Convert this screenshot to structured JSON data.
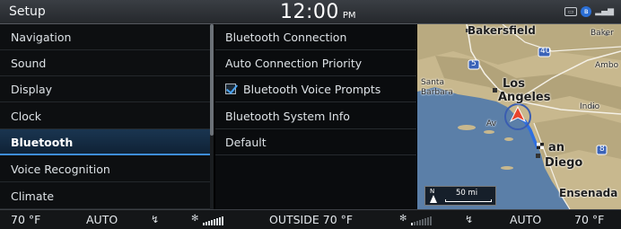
{
  "header": {
    "title": "Setup",
    "time": "12:00",
    "ampm": "PM",
    "status_icons": [
      "mic-icon",
      "bluetooth-icon",
      "signal-icon"
    ]
  },
  "menu": {
    "items": [
      {
        "label": "Navigation",
        "selected": false
      },
      {
        "label": "Sound",
        "selected": false
      },
      {
        "label": "Display",
        "selected": false
      },
      {
        "label": "Clock",
        "selected": false
      },
      {
        "label": "Bluetooth",
        "selected": true
      },
      {
        "label": "Voice Recognition",
        "selected": false
      },
      {
        "label": "Climate",
        "selected": false
      }
    ]
  },
  "options": {
    "items": [
      {
        "label": "Bluetooth Connection"
      },
      {
        "label": "Auto Connection Priority"
      },
      {
        "label": "Bluetooth Voice Prompts",
        "checked": true
      },
      {
        "label": "Bluetooth System Info"
      },
      {
        "label": "Default"
      }
    ]
  },
  "map": {
    "labels": {
      "bakersfield": "Bakersfield",
      "baker": "Baker",
      "amboy": "Ambo",
      "santa_barbara_1": "Santa",
      "santa_barbara_2": "Barbara",
      "los": "Los",
      "angeles": "Angeles",
      "indio": "Indio",
      "san": "an",
      "diego": "Diego",
      "ensenada": "Ensenada",
      "avalon": "Av",
      "route_5": "5",
      "route_40": "40",
      "route_8": "8"
    },
    "scale": {
      "north": "N",
      "distance": "50 mi"
    },
    "colors": {
      "ocean": "#5b7fa8",
      "land": "#c9b98f",
      "route": "#2f6fe0"
    }
  },
  "climate": {
    "left_temp": "70 °F",
    "left_mode": "AUTO",
    "outside": "OUTSIDE  70 °F",
    "right_mode": "AUTO",
    "right_temp": "70 °F"
  }
}
